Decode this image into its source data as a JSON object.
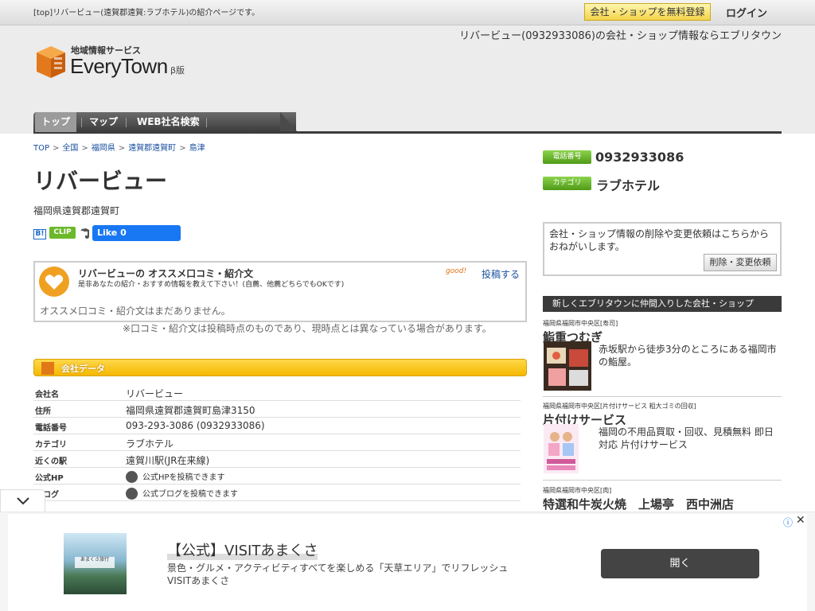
{
  "topbar": {
    "intro": "[top]リバービュー(遠賀郡遠賀:ラブホテル)の紹介ページです。",
    "register_label": "会社・ショップを無料登録",
    "login_label": "ログイン"
  },
  "header": {
    "tagline": "リバービュー(0932933086)の会社・ショップ情報ならエブリタウン",
    "logo_sub": "地域情報サービス",
    "logo_main": "EveryTown",
    "logo_beta": "β版"
  },
  "nav": {
    "items": [
      {
        "label": "トップ"
      },
      {
        "label": "マップ"
      },
      {
        "label": "WEB社名検索"
      }
    ]
  },
  "breadcrumb": [
    "TOP",
    "全国",
    "福岡県",
    "遠賀郡遠賀町",
    "島津"
  ],
  "shop": {
    "name": "リバービュー",
    "area": "福岡県遠賀郡遠賀町",
    "fb_like": "Like 0",
    "clip": "CLIP",
    "hatena": "B!"
  },
  "review": {
    "title": "リバービューの オススメ口コミ・紹介文",
    "subtitle": "是非あなたの紹介・おすすめ情報を教えて下さい！(自薦、他薦どちらでもOKです)",
    "good": "good!",
    "post_label": "投稿する",
    "empty": "オススメ口コミ・紹介文はまだありません。",
    "note": "※口コミ・紹介文は投稿時点のものであり、現時点とは異なっている場合があります。"
  },
  "company": {
    "header": "会社データ",
    "rows": [
      {
        "key": "会社名",
        "value": "リバービュー"
      },
      {
        "key": "住所",
        "value": "福岡県遠賀郡遠賀町島津3150"
      },
      {
        "key": "電話番号",
        "value": "093-293-3086 (0932933086)"
      },
      {
        "key": "カテゴリ",
        "value": "ラブホテル"
      },
      {
        "key": "近くの駅",
        "value": "遠賀川駅(JR在来線)"
      },
      {
        "key": "公式HP",
        "value": "公式HPを投稿できます"
      },
      {
        "key": "ブログ",
        "value": "公式ブログを投稿できます"
      }
    ]
  },
  "side": {
    "phone_badge": "電話番号",
    "phone": "0932933086",
    "category_badge": "カテゴリ",
    "category": "ラブホテル",
    "request_text": "会社・ショップ情報の削除や変更依頼はこちらからおねがいします。",
    "request_button": "削除・変更依頼",
    "new_header": "新しくエブリタウンに仲間入りした会社・ショップ",
    "new_shops": [
      {
        "loc": "福岡県福岡市中央区[寿司]",
        "name": "鮨重つむぎ",
        "desc": "赤坂駅から徒歩3分のところにある福岡市の鮨屋。"
      },
      {
        "loc": "福岡県福岡市中央区[片付けサービス 粗大ゴミの回収]",
        "name": "片付けサービス",
        "desc": "福岡の不用品買取・回収、見積無料 即日対応 片付けサービス"
      },
      {
        "loc": "福岡県福岡市中央区[肉]",
        "name": "特選和牛炭火焼　上場亭　西中洲店",
        "desc": ""
      }
    ]
  },
  "ad": {
    "title": "【公式】VISITあまくさ",
    "body": "景色・グルメ・アクティビティすべてを楽しめる「天草エリア」でリフレッシュ VISITあまくさ",
    "open_label": "開く",
    "image_caption": "あまくさ旅行"
  }
}
